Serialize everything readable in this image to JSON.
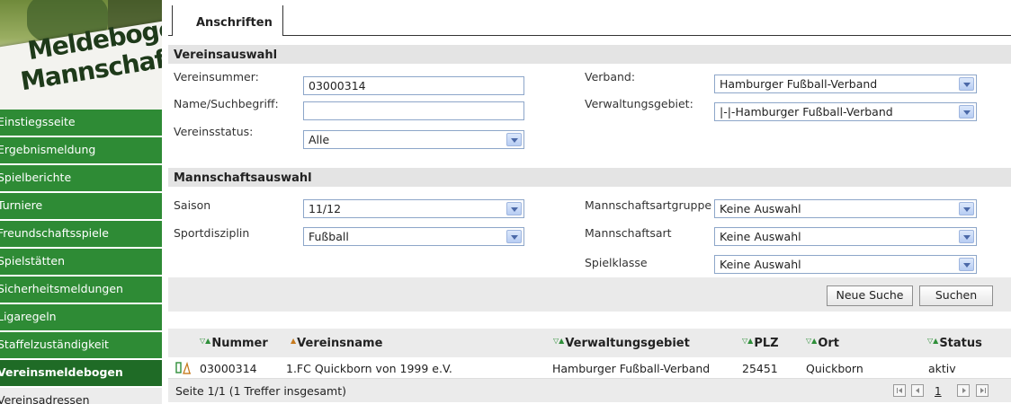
{
  "banner": {
    "line1": "Meldebogen",
    "line2": "Mannschaft:"
  },
  "sidebar": {
    "items": [
      {
        "label": "Einstiegsseite"
      },
      {
        "label": "Ergebnismeldung"
      },
      {
        "label": "Spielberichte"
      },
      {
        "label": "Turniere"
      },
      {
        "label": "Freundschaftsspiele"
      },
      {
        "label": "Spielstätten"
      },
      {
        "label": "Sicherheitsmeldungen"
      },
      {
        "label": "Ligaregeln"
      },
      {
        "label": "Staffelzuständigkeit"
      },
      {
        "label": "Vereinsmeldebogen"
      },
      {
        "label": "Vereinsadressen"
      }
    ]
  },
  "tabs": {
    "active": "Anschriften"
  },
  "vereinsauswahl": {
    "title": "Vereinsauswahl",
    "vereinsnummer_label": "Vereinsummer:",
    "vereinsnummer_value": "03000314",
    "name_label": "Name/Suchbegriff:",
    "name_value": "",
    "status_label": "Vereinsstatus:",
    "status_value": "Alle",
    "verband_label": "Verband:",
    "verband_value": "Hamburger Fußball-Verband",
    "gebiet_label": "Verwaltungsgebiet:",
    "gebiet_value": "|-|-Hamburger Fußball-Verband"
  },
  "mannschaftsauswahl": {
    "title": "Mannschaftsauswahl",
    "saison_label": "Saison",
    "saison_value": "11/12",
    "disziplin_label": "Sportdisziplin",
    "disziplin_value": "Fußball",
    "artgruppe_label": "Mannschaftsartgruppe",
    "artgruppe_value": "Keine Auswahl",
    "art_label": "Mannschaftsart",
    "art_value": "Keine Auswahl",
    "klasse_label": "Spielklasse",
    "klasse_value": "Keine Auswahl"
  },
  "buttons": {
    "neue_suche": "Neue Suche",
    "suchen": "Suchen"
  },
  "table": {
    "columns": [
      "Nummer",
      "Vereinsname",
      "Verwaltungsgebiet",
      "PLZ",
      "Ort",
      "Status"
    ],
    "rows": [
      [
        "03000314",
        "1.FC Quickborn von 1999 e.V.",
        "Hamburger Fußball-Verband",
        "25451",
        "Quickborn",
        "aktiv"
      ]
    ]
  },
  "pager": {
    "info": "Seite 1/1 (1 Treffer insgesamt)",
    "page": "1"
  }
}
